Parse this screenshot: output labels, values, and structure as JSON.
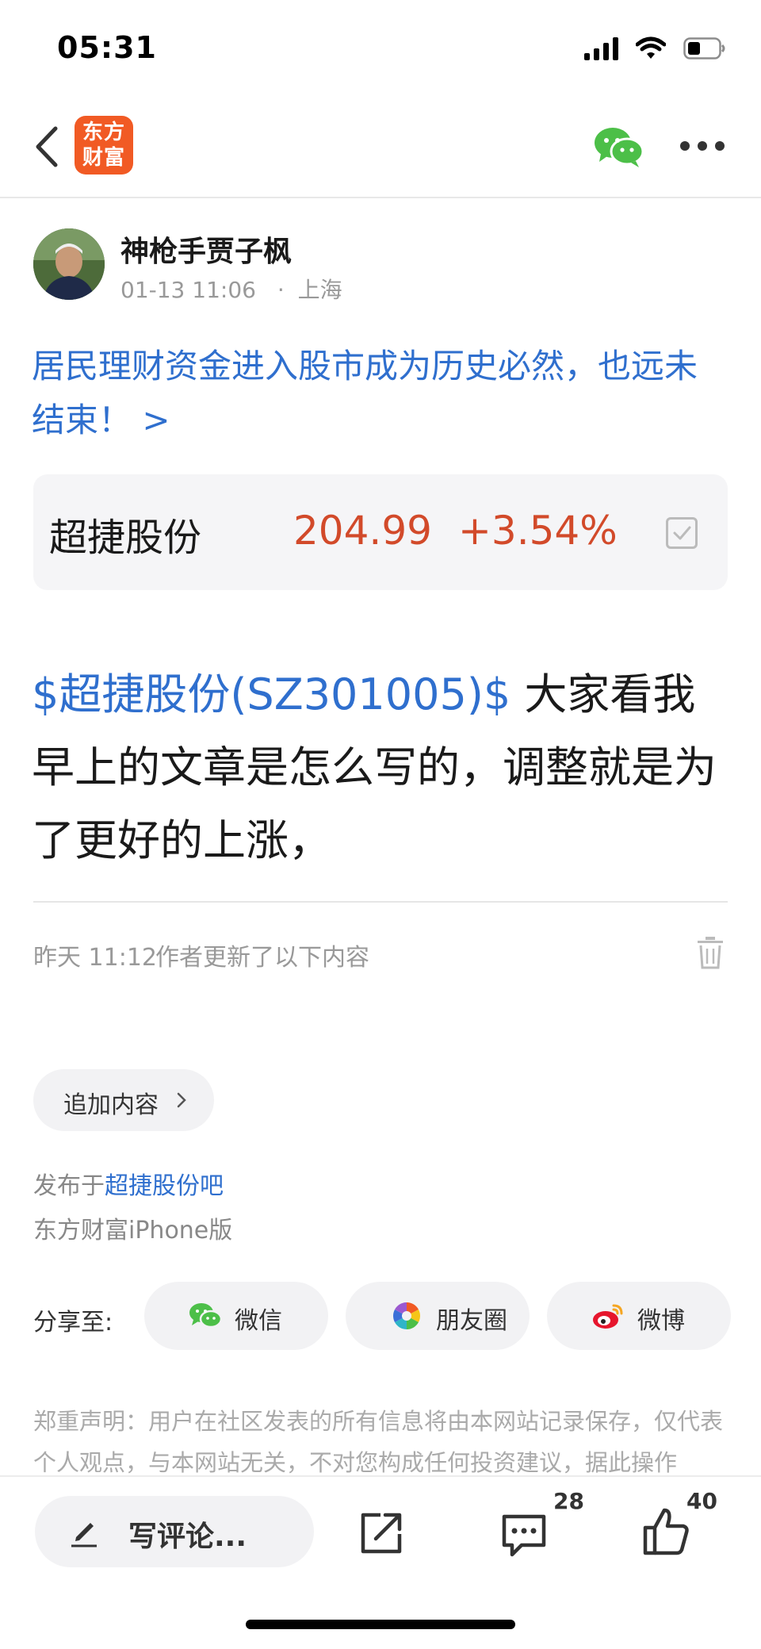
{
  "status_bar": {
    "time": "05:31"
  },
  "nav": {
    "logo_line1": "东方",
    "logo_line2": "财富"
  },
  "author": {
    "name": "神枪手贾子枫",
    "time": "01-13 11:06",
    "location_separator": "·",
    "location": "上海"
  },
  "post": {
    "title": "居民理财资金进入股市成为历史必然，也远未结束！ >"
  },
  "stock_card": {
    "name": "超捷股份",
    "price": "204.99",
    "change": "+3.54%"
  },
  "content": {
    "tag": "$超捷股份(SZ301005)$",
    "body": " 大家看我早上的文章是怎么写的，调整就是为了更好的上涨，"
  },
  "update": {
    "time": "昨天 11:12",
    "text": "作者更新了以下内容"
  },
  "append_button": {
    "label": "追加内容"
  },
  "publish": {
    "prefix": "发布于",
    "bar_name": "超捷股份吧",
    "client": "东方财富iPhone版"
  },
  "share": {
    "label": "分享至:",
    "buttons": [
      {
        "label": "微信",
        "icon": "wechat-icon"
      },
      {
        "label": "朋友圈",
        "icon": "moments-icon"
      },
      {
        "label": "微博",
        "icon": "weibo-icon"
      }
    ]
  },
  "disclaimer": "郑重声明：用户在社区发表的所有信息将由本网站记录保存，仅代表个人观点，与本网站无关，不对您构成任何投资建议，据此操作",
  "bottom_bar": {
    "comment_placeholder": "写评论...",
    "comments_count": "28",
    "likes_count": "40"
  },
  "colors": {
    "accent_blue": "#2f6fce",
    "stock_red": "#d24a2a",
    "brand_orange": "#f15a24",
    "wechat_green": "#4cbf48"
  }
}
